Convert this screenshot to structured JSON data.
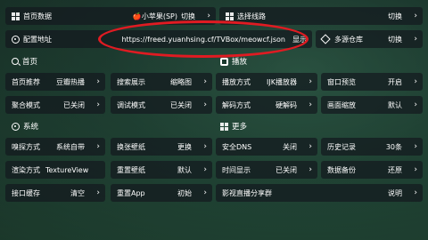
{
  "row1": {
    "home_data_label": "首页数据",
    "source_name": "小苹果(SP)",
    "source_action": "切换",
    "route_label": "选择线路",
    "route_action": "切换"
  },
  "row2": {
    "config_label": "配置地址",
    "config_url": "https://freed.yuanhsing.cf/TVBox/meowcf.json",
    "config_action": "显示",
    "repo_label": "多源仓库",
    "repo_action": "切换"
  },
  "sections": {
    "home": "首页",
    "play": "播放",
    "system": "系统",
    "more": "更多"
  },
  "home_rows": [
    {
      "label": "首页推荐",
      "value": "豆瓣热播"
    },
    {
      "label": "聚合模式",
      "value": "已关闭"
    }
  ],
  "search_rows": [
    {
      "label": "搜索展示",
      "value": "缩略图"
    },
    {
      "label": "调试模式",
      "value": "已关闭"
    }
  ],
  "play_rows": [
    {
      "label": "播放方式",
      "value": "IJK播放器"
    },
    {
      "label": "解码方式",
      "value": "硬解码"
    }
  ],
  "window_rows": [
    {
      "label": "窗口预览",
      "value": "开启"
    },
    {
      "label": "画面缩放",
      "value": "默认"
    }
  ],
  "system_rows": [
    {
      "label": "嗅探方式",
      "value": "系统自带"
    },
    {
      "label": "渲染方式",
      "value": "TextureView"
    },
    {
      "label": "接口缓存",
      "value": "清空"
    }
  ],
  "wallpaper_rows": [
    {
      "label": "换张壁纸",
      "value": "更换"
    },
    {
      "label": "重置壁纸",
      "value": "默认"
    },
    {
      "label": "重置App",
      "value": "初始"
    }
  ],
  "more_rows": [
    {
      "label": "安全DNS",
      "value": "关闭"
    },
    {
      "label": "时间显示",
      "value": "已关闭"
    }
  ],
  "history_rows": [
    {
      "label": "历史记录",
      "value": "30条"
    },
    {
      "label": "数据备份",
      "value": "还原"
    }
  ],
  "live_group": {
    "label": "影视直播分享群",
    "value": "说明"
  },
  "colors": {
    "highlight_ellipse": "#e01b22",
    "tile_bg": "rgba(20,25,30,0.72)",
    "wallpaper": "#2f6b52"
  }
}
